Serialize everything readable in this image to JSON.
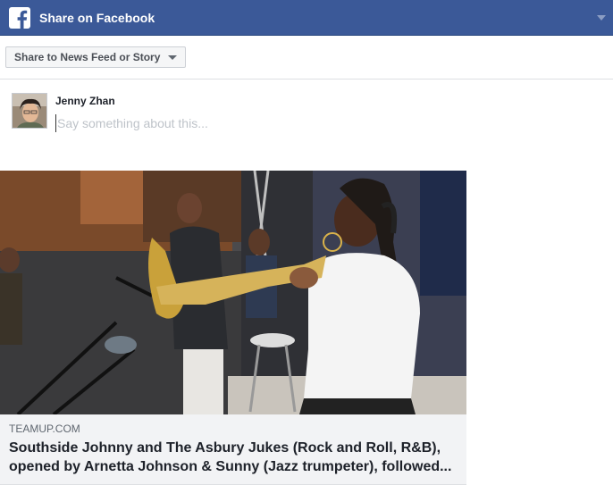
{
  "header": {
    "title": "Share on Facebook",
    "logo_icon": "facebook-f-icon",
    "menu_icon": "caret-down-icon",
    "brand_color": "#3b5998"
  },
  "share_target": {
    "label": "Share to News Feed or Story",
    "icon": "caret-down-icon"
  },
  "composer": {
    "user_name": "Jenny Zhan",
    "placeholder": "Say something about this...",
    "value": ""
  },
  "link_preview": {
    "image_description_icon": "photo-musicians-icon",
    "domain": "TEAMUP.COM",
    "title_line1": "Southside Johnny and The Asbury Jukes (Rock and Roll, R&B),",
    "title_line2": "opened by Arnetta Johnson & Sunny (Jazz trumpeter), followed..."
  }
}
